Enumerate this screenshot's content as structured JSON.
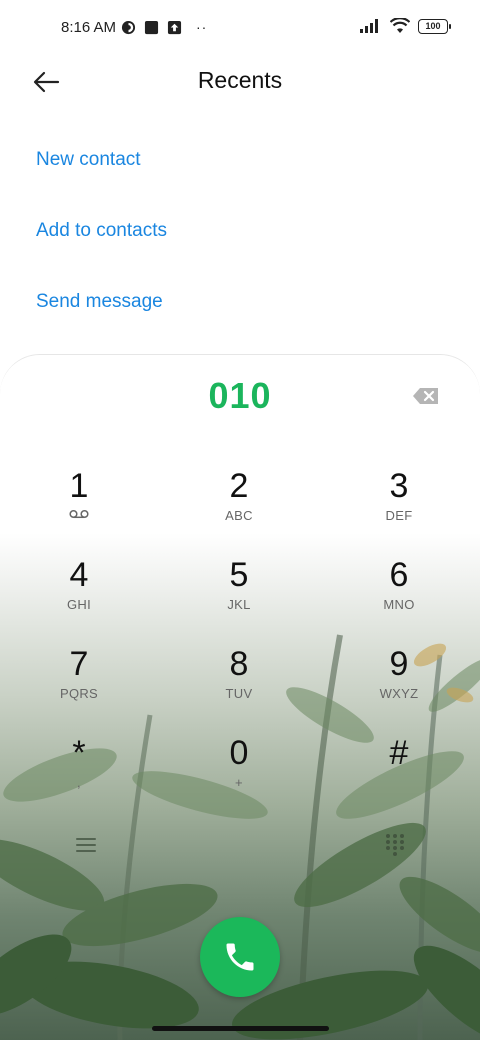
{
  "status_bar": {
    "time": "8:16 AM",
    "battery": "100",
    "icons": [
      "vpn-icon",
      "square-icon",
      "upload-icon",
      "more-dots-icon",
      "signal-icon",
      "wifi-icon",
      "battery-icon"
    ],
    "dots": "··"
  },
  "header": {
    "title": "Recents",
    "back_icon": "arrow-left-icon"
  },
  "actions": {
    "new_contact": "New contact",
    "add_to_contacts": "Add to contacts",
    "send_message": "Send message"
  },
  "dialpad": {
    "entered_number": "010",
    "keys": [
      {
        "num": "1",
        "sub": ""
      },
      {
        "num": "2",
        "sub": "ABC"
      },
      {
        "num": "3",
        "sub": "DEF"
      },
      {
        "num": "4",
        "sub": "GHI"
      },
      {
        "num": "5",
        "sub": "JKL"
      },
      {
        "num": "6",
        "sub": "MNO"
      },
      {
        "num": "7",
        "sub": "PQRS"
      },
      {
        "num": "8",
        "sub": "TUV"
      },
      {
        "num": "9",
        "sub": "WXYZ"
      },
      {
        "num": "*",
        "sub": ","
      },
      {
        "num": "0",
        "sub": "+"
      },
      {
        "num": "#",
        "sub": ""
      }
    ],
    "voicemail_icon": "voicemail-icon",
    "menu_icon": "menu-icon",
    "dialpad_icon": "dialpad-grid-icon",
    "call_icon": "phone-icon",
    "backspace_icon": "backspace-icon"
  },
  "colors": {
    "accent_link": "#1a86e0",
    "number_green": "#1bb55c",
    "call_green": "#1bb85a"
  }
}
